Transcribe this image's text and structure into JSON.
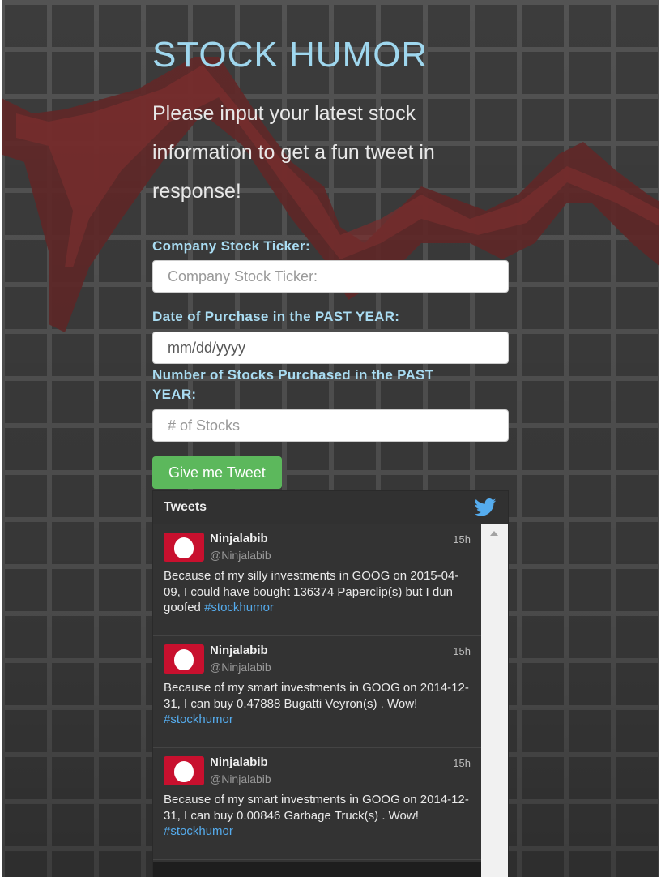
{
  "title": "STOCK HUMOR",
  "intro": "Please input your latest stock information to get a fun tweet in response!",
  "form": {
    "ticker": {
      "label": "Company Stock Ticker:",
      "placeholder": "Company Stock Ticker:"
    },
    "date": {
      "label": "Date of Purchase in the PAST YEAR:",
      "placeholder": "mm/dd/yyyy"
    },
    "count": {
      "label": "Number of Stocks Purchased in the PAST YEAR:",
      "placeholder": "# of Stocks"
    },
    "submit_label": "Give me Tweet"
  },
  "widget": {
    "header": "Tweets",
    "tweets": [
      {
        "name": "Ninjalabib",
        "handle": "@Ninjalabib",
        "time": "15h",
        "text": "Because of my silly investments in GOOG on 2015-04-09, I could have bought 136374 Paperclip(s) but I dun goofed",
        "hashtag": "#stockhumor"
      },
      {
        "name": "Ninjalabib",
        "handle": "@Ninjalabib",
        "time": "15h",
        "text": "Because of my smart investments in GOOG on 2014-12-31, I can buy 0.47888 Bugatti Veyron(s) . Wow!",
        "hashtag": "#stockhumor"
      },
      {
        "name": "Ninjalabib",
        "handle": "@Ninjalabib",
        "time": "15h",
        "text": "Because of my smart investments in GOOG on 2014-12-31, I can buy 0.00846 Garbage Truck(s) . Wow!",
        "hashtag": "#stockhumor"
      }
    ]
  },
  "colors": {
    "title": "#9fd7ee",
    "label": "#a9dcf2",
    "button": "#5cb85c",
    "hashtag": "#55acee",
    "avatar": "#c8102e",
    "twitter_bird": "#55acee"
  },
  "icons": {
    "twitter": "twitter-bird-icon",
    "avatar": "egg-avatar-icon",
    "scroll_up": "scroll-up-arrow-icon"
  }
}
